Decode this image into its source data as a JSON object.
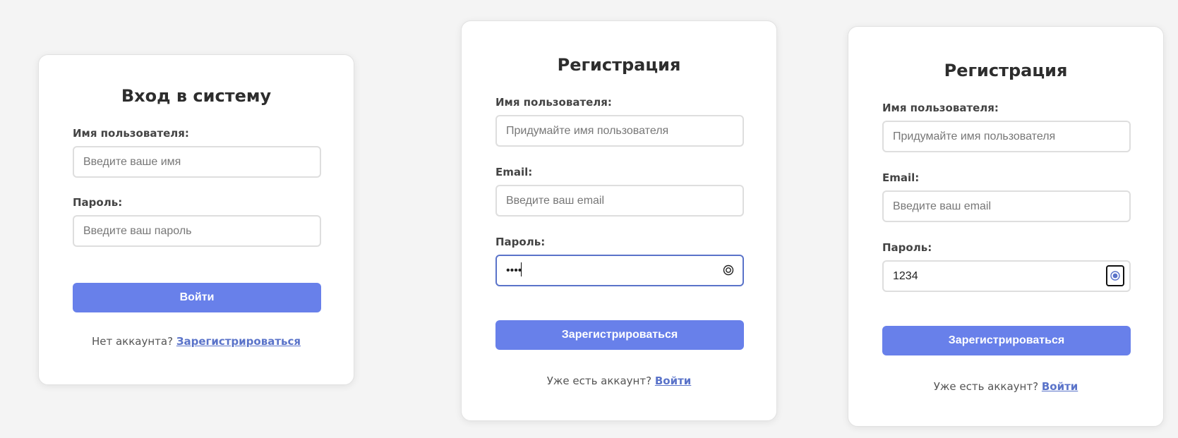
{
  "login_card": {
    "title": "Вход в систему",
    "username_label": "Имя пользователя:",
    "username_placeholder": "Введите ваше имя",
    "username_value": "",
    "password_label": "Пароль:",
    "password_placeholder": "Введите ваш пароль",
    "password_value": "",
    "submit_label": "Войти",
    "footer_text": "Нет аккаунта?",
    "footer_link": "Зарегистрироваться"
  },
  "register_card_masked": {
    "title": "Регистрация",
    "username_label": "Имя пользователя:",
    "username_placeholder": "Придумайте имя пользователя",
    "username_value": "",
    "email_label": "Email:",
    "email_placeholder": "Введите ваш email",
    "email_value": "",
    "password_label": "Пароль:",
    "password_value": "1234",
    "password_visible": false,
    "password_focused": true,
    "toggle_icon": "eye-icon",
    "submit_label": "Зарегистрироваться",
    "footer_text": "Уже есть аккаунт?",
    "footer_link": "Войти"
  },
  "register_card_visible": {
    "title": "Регистрация",
    "username_label": "Имя пользователя:",
    "username_placeholder": "Придумайте имя пользователя",
    "username_value": "",
    "email_label": "Email:",
    "email_placeholder": "Введите ваш email",
    "email_value": "",
    "password_label": "Пароль:",
    "password_value": "1234",
    "password_visible": true,
    "toggle_icon": "eye-icon",
    "submit_label": "Зарегистрироваться",
    "footer_text": "Уже есть аккаунт?",
    "footer_link": "Войти"
  },
  "colors": {
    "page_background": "#f4f4f4",
    "accent": "#6880ea",
    "link": "#5a73c9",
    "focus_border": "#5a73c9"
  }
}
